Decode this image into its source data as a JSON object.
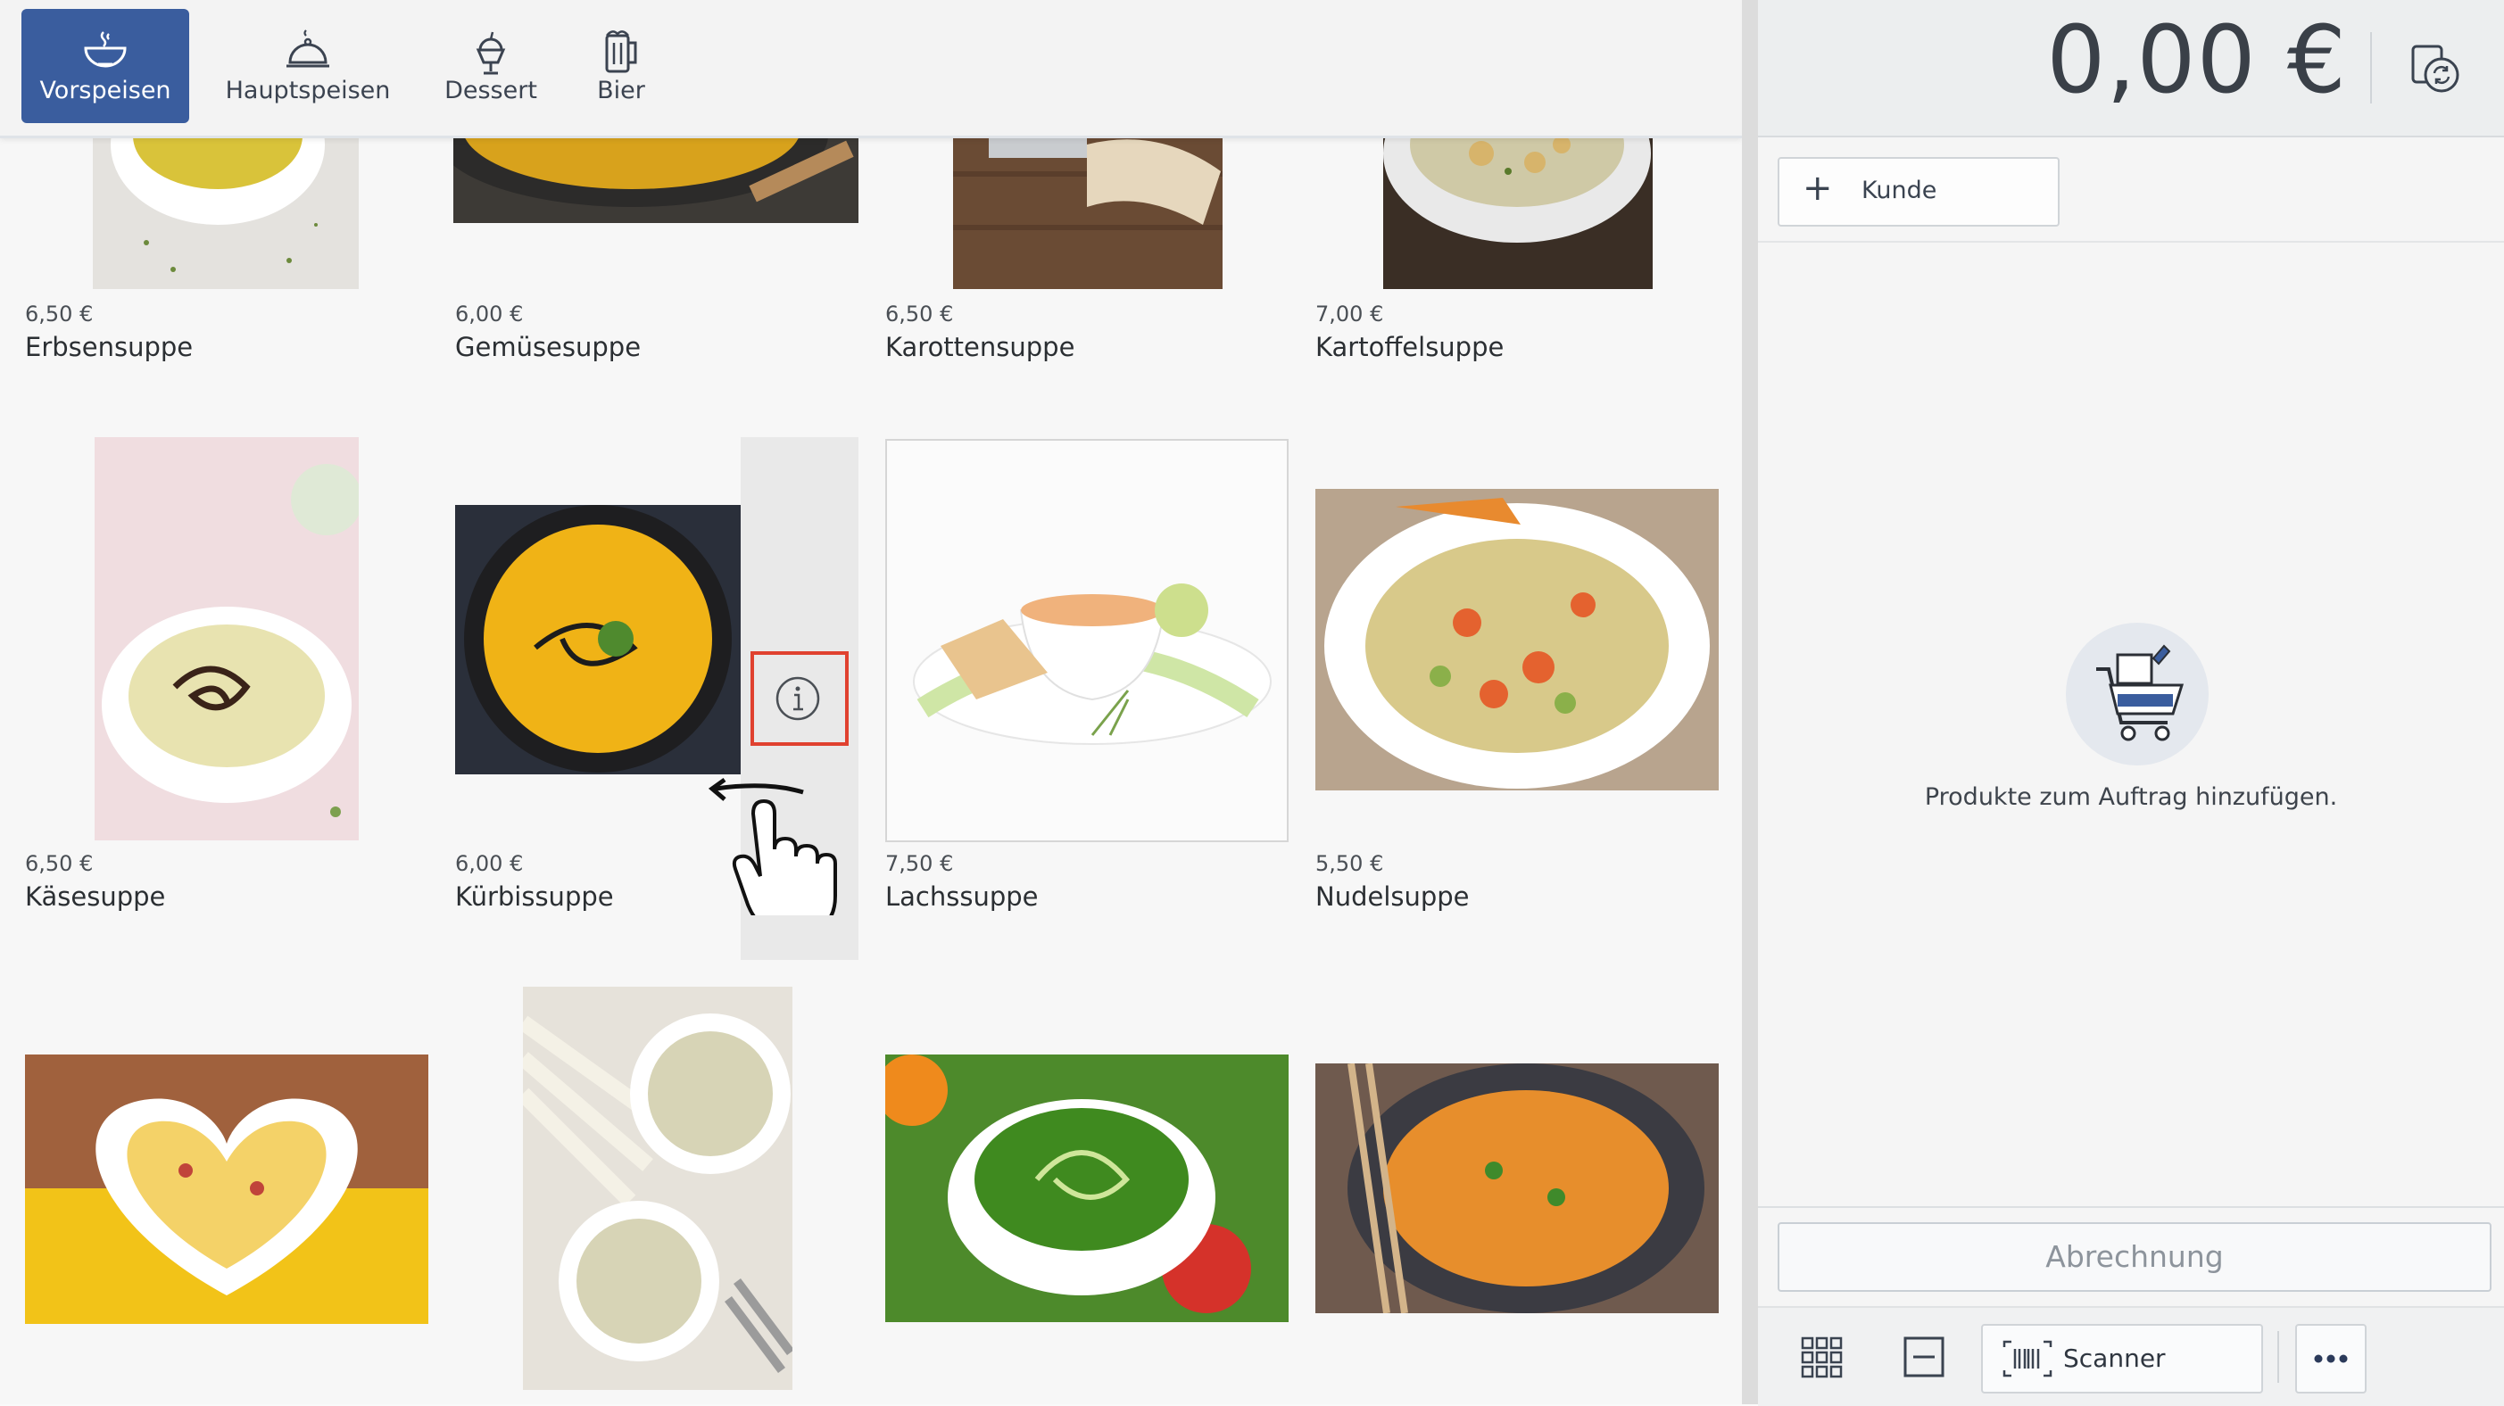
{
  "categories": [
    {
      "label": "Vorspeisen",
      "icon": "soup-bowl-icon",
      "active": true
    },
    {
      "label": "Hauptspeisen",
      "icon": "cloche-icon",
      "active": false
    },
    {
      "label": "Dessert",
      "icon": "ice-cream-icon",
      "active": false
    },
    {
      "label": "Bier",
      "icon": "beer-mug-icon",
      "active": false
    }
  ],
  "products": [
    {
      "price": "6,50 €",
      "name": "Erbsensuppe"
    },
    {
      "price": "6,00 €",
      "name": "Gemüsesuppe"
    },
    {
      "price": "6,50 €",
      "name": "Karottensuppe"
    },
    {
      "price": "7,00 €",
      "name": "Kartoffelsuppe"
    },
    {
      "price": "6,50 €",
      "name": "Käsesuppe"
    },
    {
      "price": "6,00 €",
      "name": "Kürbissuppe"
    },
    {
      "price": "7,50 €",
      "name": "Lachssuppe"
    },
    {
      "price": "5,50 €",
      "name": "Nudelsuppe"
    }
  ],
  "order": {
    "total": "0,00 €",
    "customer_button": "Kunde",
    "empty_message": "Produkte zum Auftrag hinzufügen.",
    "checkout_button": "Abrechnung"
  },
  "toolbar": {
    "scanner_label": "Scanner"
  },
  "colors": {
    "accent": "#3a5d9e",
    "highlight_box": "#e0412f"
  }
}
